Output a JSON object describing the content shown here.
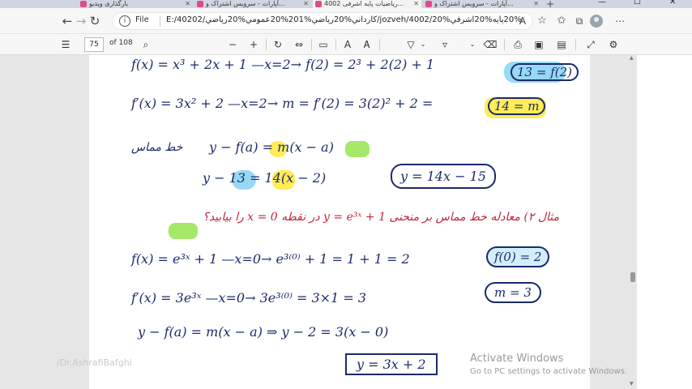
{
  "browser": {
    "tabs": [
      {
        "label": "بارگذاری ویدیو",
        "active": false
      },
      {
        "label": "آپارات - سرویس اشتراک و...",
        "active": false
      },
      {
        "label": "ریاضیات پایه اشرفی 4002...",
        "active": true
      },
      {
        "label": "آپارات - سرویس اشتراک و...",
        "active": false
      }
    ],
    "file_label": "File",
    "url": "E:/40202/کارداني%20رياضي%201%20عمومي%20رياضي/jozveh/4002/رياضيات%20پايه%20اشرفي%20.pdf"
  },
  "pdf_toolbar": {
    "page_number": "75",
    "page_count": "of 108"
  },
  "document": {
    "line1": "f(x) = x³ + 2x + 1   —x=2→   f(2) = 2³ + 2(2) + 1",
    "line1_result": "13 = f(2)",
    "line2": "f′(x) = 3x² + 2   —x=2→   m = f′(2) = 3(2)² + 2 =",
    "line2_result": "14 = m",
    "tangent_label": "خط مماس",
    "line3": "y − f(a) = m(x − a)",
    "line4": "y − 13 = 14(x − 2)",
    "line4_result": "y = 14x − 15",
    "example_title": "مثال ۲) معادله خط مماس بر منحنی y = e³ˣ + 1 در نقطه x = 0 را بیابید؟",
    "line5": "f(x) = e³ˣ + 1   —x=0→   e³⁽⁰⁾ + 1 = 1 + 1 = 2",
    "line5_result": "f(0) = 2",
    "line6": "f′(x) = 3e³ˣ   —x=0→   3e³⁽⁰⁾ = 3×1 = 3",
    "line6_result": "m = 3",
    "line7": "y − f(a) = m(x − a)   ⇒   y − 2 = 3(x − 0)",
    "line7_result": "y = 3x + 2"
  },
  "watermark": "/Dr.AshrafiBafghi",
  "activation": {
    "title": "Activate Windows",
    "subtitle": "Go to PC settings to activate Windows."
  },
  "colors": {
    "ink": "#1b2a6b",
    "red_ink": "#c0263a",
    "highlight_blue": "#7dcff2",
    "highlight_yellow": "#ffe93a",
    "highlight_green": "#9be55a"
  }
}
